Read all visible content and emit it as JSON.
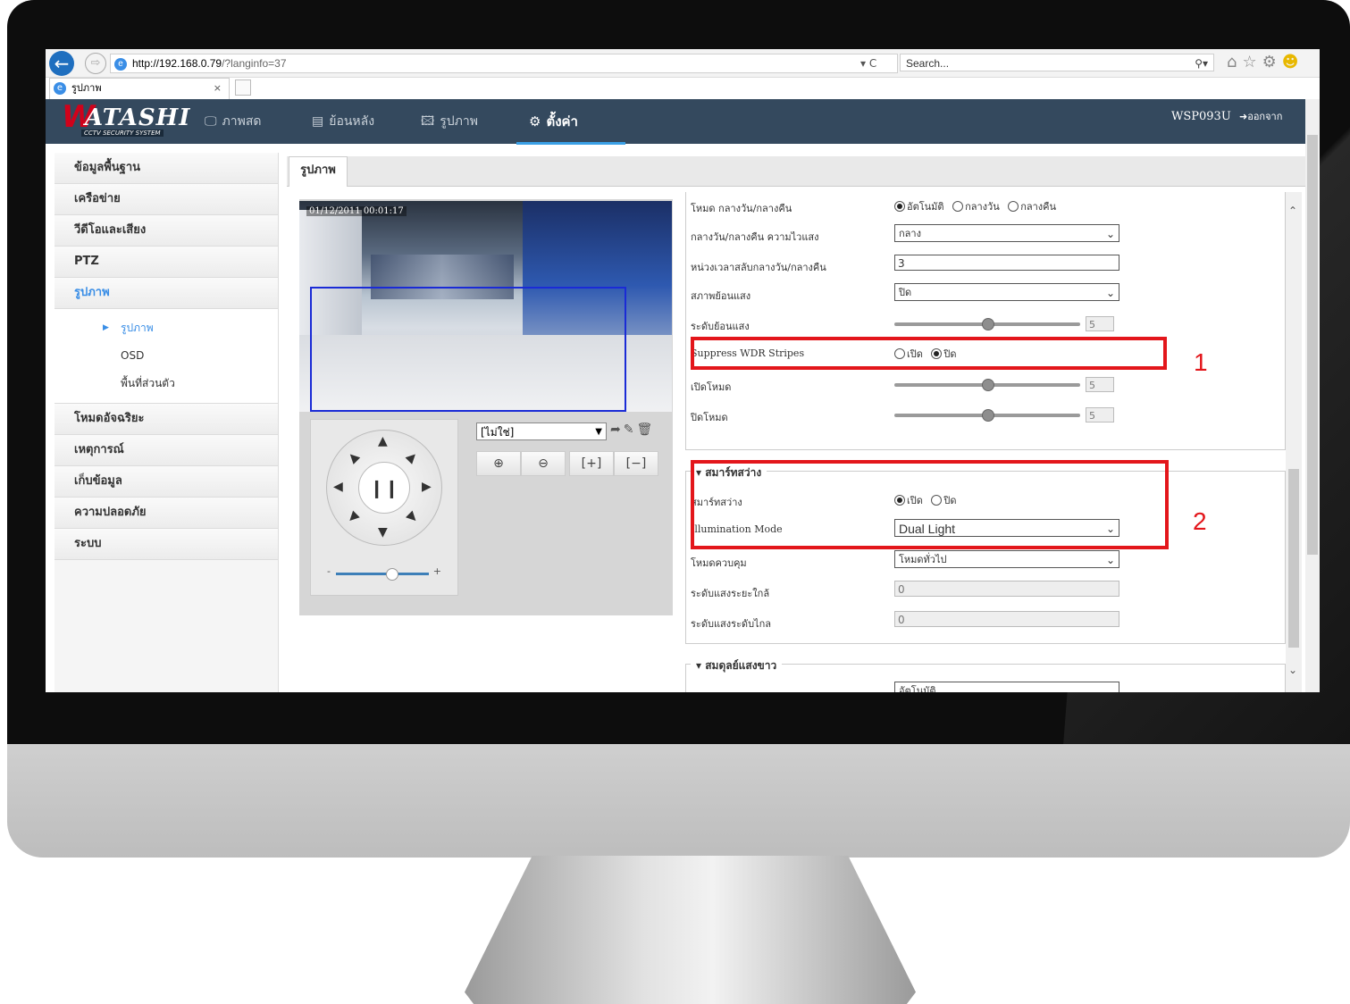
{
  "browser": {
    "url_host": "http://192.168.0.79",
    "url_path": "/?langinfo=37",
    "url_tools": "▾ C",
    "search_placeholder": "Search...",
    "tab_title": "รูปภาพ",
    "tab_close": "×"
  },
  "app": {
    "logo_text": "ATASHI",
    "logo_letter": "W",
    "logo_subtitle": "CCTV SECURITY SYSTEM",
    "menu": [
      {
        "label": "ภาพสด",
        "icon": "🖵"
      },
      {
        "label": "ย้อนหลัง",
        "icon": "▤"
      },
      {
        "label": "รูปภาพ",
        "icon": "🖾"
      },
      {
        "label": "ตั้งค่า",
        "icon": "⚙"
      }
    ],
    "model": "WSP093U",
    "logout": "ออกจากระบบ"
  },
  "sidebar": {
    "items": [
      "ข้อมูลพื้นฐาน",
      "เครือข่าย",
      "วีดีโอและเสียง",
      "PTZ",
      "รูปภาพ",
      "โหมดอัจฉริยะ",
      "เหตุการณ์",
      "เก็บข้อมูล",
      "ความปลอดภัย",
      "ระบบ"
    ],
    "sub_items": [
      "รูปภาพ",
      "OSD",
      "พื้นที่ส่วนตัว"
    ]
  },
  "content": {
    "tab_label": "รูปภาพ",
    "osd_time": "01/12/2011 00:01:17",
    "preset_value": "[ไม่ใช่]",
    "zoom_minus": "-",
    "zoom_plus": "+"
  },
  "settings": {
    "day_night_mode": {
      "label": "โหมด กลางวัน/กลางคืน",
      "options": [
        "อัตโนมัติ",
        "กลางวัน",
        "กลางคืน"
      ],
      "selected": 0
    },
    "day_night_sensitivity": {
      "label": "กลางวัน/กลางคืน ความไวแสง",
      "value": "กลาง"
    },
    "switch_delay": {
      "label": "หน่วงเวลาสลับกลางวัน/กลางคืน",
      "value": "3"
    },
    "backlight": {
      "label": "สภาพย้อนแสง",
      "value": "ปิด"
    },
    "backlight_level": {
      "label": "ระดับย้อนแสง",
      "value": "5",
      "fraction": 0.5
    },
    "suppress_wdr": {
      "label": "Suppress WDR Stripes",
      "options": [
        "เปิด",
        "ปิด"
      ],
      "selected": 1
    },
    "mode_on": {
      "label": "เปิดโหมด",
      "value": "5",
      "fraction": 0.5
    },
    "mode_off": {
      "label": "ปิดโหมด",
      "value": "5",
      "fraction": 0.5
    },
    "smart_ir_group": "สมาร์ทสว่าง",
    "smart_ir": {
      "label": "สมาร์ทสว่าง",
      "options": [
        "เปิด",
        "ปิด"
      ],
      "selected": 0
    },
    "illumination_mode": {
      "label": "Illumination Mode",
      "value": "Dual Light"
    },
    "control_mode": {
      "label": "โหมดควบคุม",
      "value": "โหมดทั่วไป"
    },
    "near_light": {
      "label": "ระดับแสงระยะใกล้",
      "value": "0"
    },
    "far_light": {
      "label": "ระดับแสงระดับไกล",
      "value": "0"
    },
    "white_balance_group": "สมดุลย์แสงขาว",
    "white_balance_value": "อัตโนมัติ"
  },
  "annotations": {
    "box1": "1",
    "box2": "2"
  },
  "colors": {
    "header": "#34495e",
    "accent": "#3a8ee6",
    "annotation": "#e3161b"
  }
}
